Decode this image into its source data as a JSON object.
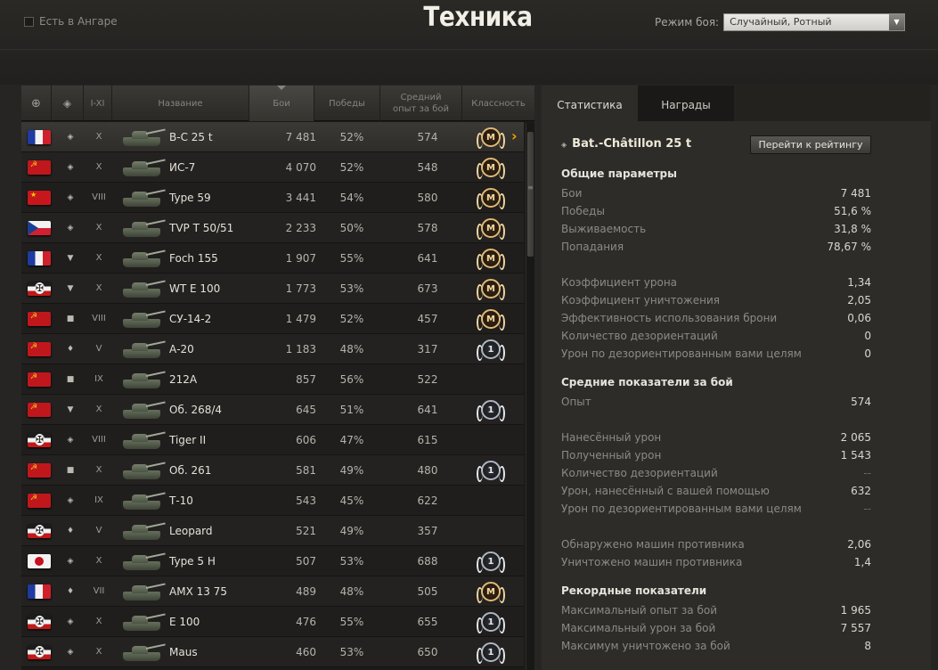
{
  "header": {
    "title": "Техника",
    "hangar_filter_label": "Есть в Ангаре",
    "mode_label": "Режим боя:",
    "mode_value": "Случайный, Ротный"
  },
  "table": {
    "columns": [
      "",
      "",
      "I-XI",
      "Название",
      "Бои",
      "Победы",
      "Средний опыт за бой",
      "Классность"
    ],
    "sort_column": "Бои",
    "rows": [
      {
        "flag": "france",
        "type_icon": "medium-tank-icon",
        "tier": "X",
        "name": "B-C 25 t",
        "battles": "7 481",
        "wins": "52%",
        "exp": "574",
        "badge": "M",
        "selected": true
      },
      {
        "flag": "ussr",
        "type_icon": "heavy-tank-icon",
        "tier": "X",
        "name": "ИС-7",
        "battles": "4 070",
        "wins": "52%",
        "exp": "548",
        "badge": "M"
      },
      {
        "flag": "china",
        "type_icon": "medium-tank-icon",
        "tier": "VIII",
        "name": "Type 59",
        "battles": "3 441",
        "wins": "54%",
        "exp": "580",
        "badge": "M"
      },
      {
        "flag": "czech",
        "type_icon": "medium-tank-icon",
        "tier": "X",
        "name": "TVP T 50/51",
        "battles": "2 233",
        "wins": "50%",
        "exp": "578",
        "badge": "M"
      },
      {
        "flag": "france",
        "type_icon": "td-icon",
        "tier": "X",
        "name": "Foch 155",
        "battles": "1 907",
        "wins": "55%",
        "exp": "641",
        "badge": "M"
      },
      {
        "flag": "germany",
        "type_icon": "td-icon",
        "tier": "X",
        "name": "WT E 100",
        "battles": "1 773",
        "wins": "53%",
        "exp": "673",
        "badge": "M"
      },
      {
        "flag": "ussr",
        "type_icon": "spg-icon",
        "tier": "VIII",
        "name": "СУ-14-2",
        "battles": "1 479",
        "wins": "52%",
        "exp": "457",
        "badge": "M"
      },
      {
        "flag": "ussr",
        "type_icon": "light-tank-icon",
        "tier": "V",
        "name": "А-20",
        "battles": "1 183",
        "wins": "48%",
        "exp": "317",
        "badge": "1"
      },
      {
        "flag": "ussr",
        "type_icon": "spg-icon",
        "tier": "IX",
        "name": "212А",
        "battles": "857",
        "wins": "56%",
        "exp": "522",
        "badge": ""
      },
      {
        "flag": "ussr",
        "type_icon": "td-icon",
        "tier": "X",
        "name": "Об. 268/4",
        "battles": "645",
        "wins": "51%",
        "exp": "641",
        "badge": "1"
      },
      {
        "flag": "germany",
        "type_icon": "heavy-tank-icon",
        "tier": "VIII",
        "name": "Tiger II",
        "battles": "606",
        "wins": "47%",
        "exp": "615",
        "badge": ""
      },
      {
        "flag": "ussr",
        "type_icon": "spg-icon",
        "tier": "X",
        "name": "Об. 261",
        "battles": "581",
        "wins": "49%",
        "exp": "480",
        "badge": "1"
      },
      {
        "flag": "ussr",
        "type_icon": "heavy-tank-icon",
        "tier": "IX",
        "name": "Т-10",
        "battles": "543",
        "wins": "45%",
        "exp": "622",
        "badge": ""
      },
      {
        "flag": "germany",
        "type_icon": "light-tank-icon",
        "tier": "V",
        "name": "Leopard",
        "battles": "521",
        "wins": "49%",
        "exp": "357",
        "badge": ""
      },
      {
        "flag": "japan",
        "type_icon": "heavy-tank-icon",
        "tier": "X",
        "name": "Type 5 H",
        "battles": "507",
        "wins": "53%",
        "exp": "688",
        "badge": "1"
      },
      {
        "flag": "france",
        "type_icon": "light-tank-icon",
        "tier": "VII",
        "name": "AMX 13 75",
        "battles": "489",
        "wins": "48%",
        "exp": "505",
        "badge": "M"
      },
      {
        "flag": "germany",
        "type_icon": "heavy-tank-icon",
        "tier": "X",
        "name": "E 100",
        "battles": "476",
        "wins": "55%",
        "exp": "655",
        "badge": "1"
      },
      {
        "flag": "germany",
        "type_icon": "heavy-tank-icon",
        "tier": "X",
        "name": "Maus",
        "battles": "460",
        "wins": "53%",
        "exp": "650",
        "badge": "1"
      }
    ]
  },
  "panel": {
    "tabs": [
      "Статистика",
      "Награды"
    ],
    "vehicle_name": "Bat.-Châtillon 25 t",
    "rating_button": "Перейти к рейтингу",
    "sections": [
      {
        "title": "Общие параметры",
        "stats": [
          {
            "label": "Бои",
            "value": "7 481"
          },
          {
            "label": "Победы",
            "value": "51,6 %"
          },
          {
            "label": "Выживаемость",
            "value": "31,8 %"
          },
          {
            "label": "Попадания",
            "value": "78,67 %"
          },
          {
            "gap": true
          },
          {
            "label": "Коэффициент урона",
            "value": "1,34"
          },
          {
            "label": "Коэффициент уничтожения",
            "value": "2,05"
          },
          {
            "label": "Эффективность использования брони",
            "value": "0,06"
          },
          {
            "label": "Количество дезориентаций",
            "value": "0"
          },
          {
            "label": "Урон по дезориентированным вами целям",
            "value": "0"
          }
        ]
      },
      {
        "title": "Средние показатели за бой",
        "stats": [
          {
            "label": "Опыт",
            "value": "574"
          },
          {
            "gap": true
          },
          {
            "label": "Нанесённый урон",
            "value": "2 065"
          },
          {
            "label": "Полученный урон",
            "value": "1 543"
          },
          {
            "label": "Количество дезориентаций",
            "value": "--",
            "dim": true
          },
          {
            "label": "Урон, нанесённый с вашей помощью",
            "value": "632"
          },
          {
            "label": "Урон по дезориентированным вами целям",
            "value": "--",
            "dim": true
          },
          {
            "gap": true
          },
          {
            "label": "Обнаружено машин противника",
            "value": "2,06"
          },
          {
            "label": "Уничтожено машин противника",
            "value": "1,4"
          }
        ]
      },
      {
        "title": "Рекордные показатели",
        "stats": [
          {
            "label": "Максимальный опыт за бой",
            "value": "1 965"
          },
          {
            "label": "Максимальный урон за бой",
            "value": "7 557"
          },
          {
            "label": "Максимум уничтожено за бой",
            "value": "8"
          }
        ]
      }
    ]
  },
  "icons": {
    "type_glyphs": {
      "medium-tank-icon": "◈",
      "heavy-tank-icon": "◈",
      "light-tank-icon": "♦",
      "td-icon": "▼",
      "spg-icon": "■"
    },
    "badge_colors": {
      "M": "#e0b878",
      "1": "#aeb5bf"
    }
  }
}
